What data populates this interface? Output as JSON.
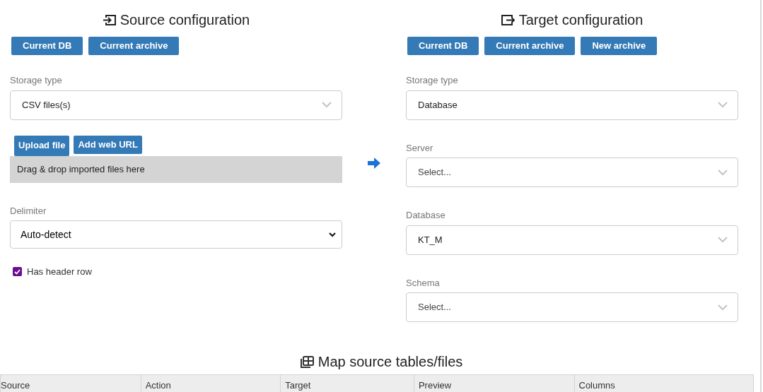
{
  "source": {
    "title": "Source configuration",
    "buttons": [
      "Current DB",
      "Current archive"
    ],
    "storage_type": {
      "label": "Storage type",
      "value": "CSV files(s)"
    },
    "upload_buttons": [
      "Upload file",
      "Add web URL"
    ],
    "drop_zone": "Drag & drop imported files here",
    "delimiter": {
      "label": "Delimiter",
      "value": "Auto-detect"
    },
    "has_header_row": {
      "label": "Has header row",
      "checked": true
    }
  },
  "target": {
    "title": "Target configuration",
    "buttons": [
      "Current DB",
      "Current archive",
      "New archive"
    ],
    "fields": [
      {
        "label": "Storage type",
        "value": "Database"
      },
      {
        "label": "Server",
        "placeholder": "Select..."
      },
      {
        "label": "Database",
        "value": "KT_M"
      },
      {
        "label": "Schema",
        "placeholder": "Select..."
      }
    ]
  },
  "mapping": {
    "title": "Map source tables/files",
    "columns": [
      "Source",
      "Action",
      "Target",
      "Preview",
      "Columns"
    ]
  }
}
